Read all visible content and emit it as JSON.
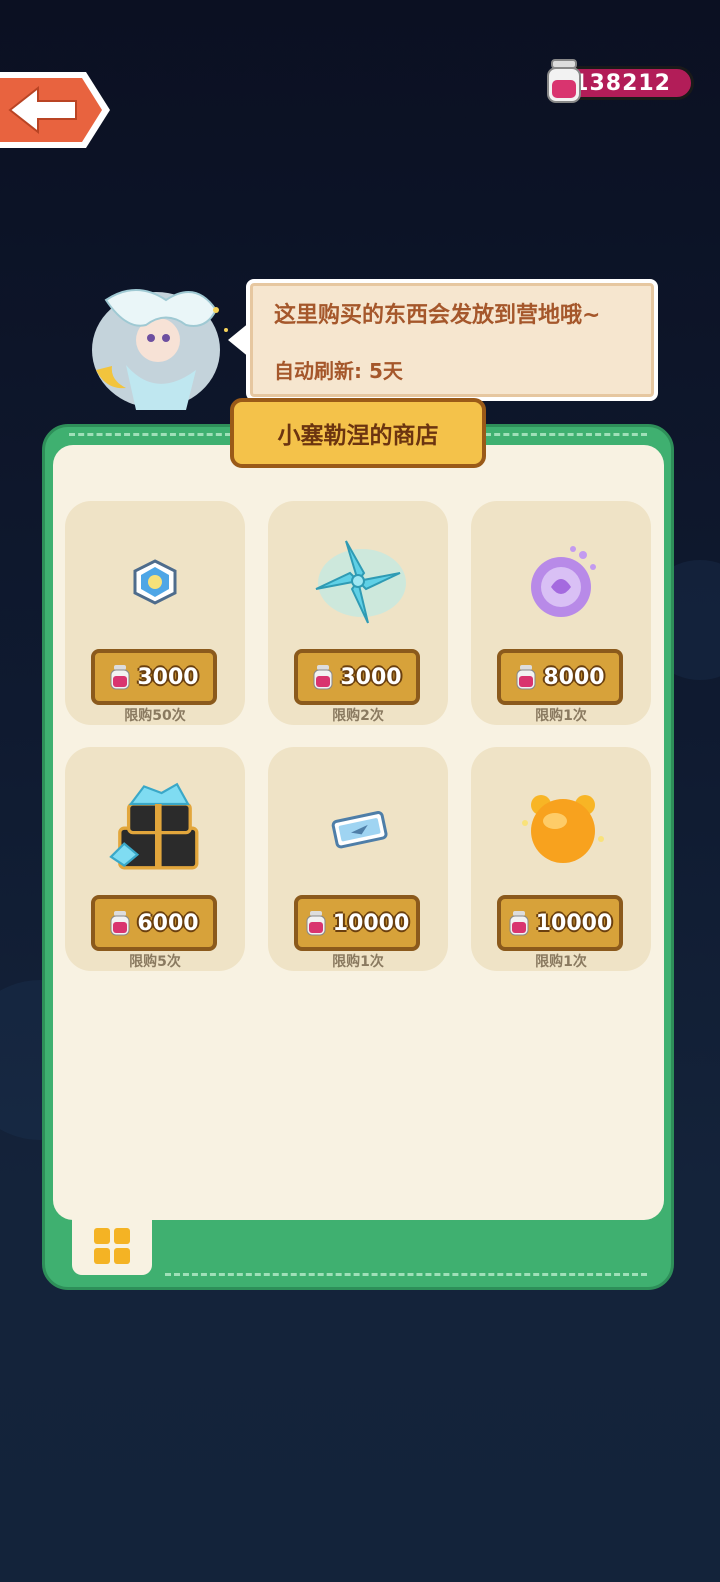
{
  "currency": {
    "value": "138212",
    "icon": "jar-icon"
  },
  "npc": {
    "message_line1": "这里购买的东西会发放到营地哦~",
    "message_line2": "自动刷新: 5天"
  },
  "shop": {
    "title": "小塞勒涅的商店",
    "items": [
      {
        "icon": "blue-badge-icon",
        "price": "3000",
        "limit": "限购50次"
      },
      {
        "icon": "pinwheel-icon",
        "price": "3000",
        "limit": "限购2次"
      },
      {
        "icon": "purple-orb-icon",
        "price": "8000",
        "limit": "限购1次"
      },
      {
        "icon": "crystal-chest-icon",
        "price": "6000",
        "limit": "限购5次"
      },
      {
        "icon": "ticket-icon",
        "price": "10000",
        "limit": "限购1次"
      },
      {
        "icon": "golden-bear-orb-icon",
        "price": "10000",
        "limit": "限购1次"
      }
    ]
  },
  "colors": {
    "panel_green": "#3fb070",
    "price_gold": "#d7a23a",
    "currency_pink": "#b21d58"
  }
}
